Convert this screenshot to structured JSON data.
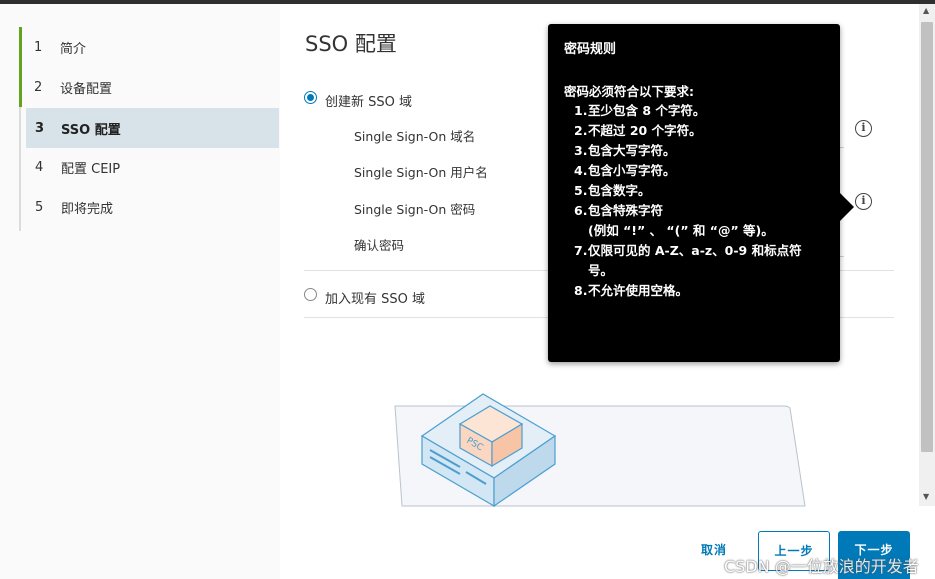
{
  "nav": {
    "items": [
      {
        "num": "1",
        "label": "简介"
      },
      {
        "num": "2",
        "label": "设备配置"
      },
      {
        "num": "3",
        "label": "SSO 配置"
      },
      {
        "num": "4",
        "label": "配置 CEIP"
      },
      {
        "num": "5",
        "label": "即将完成"
      }
    ],
    "accent_color": "#62a420",
    "active_index": 2
  },
  "main": {
    "title": "SSO 配置",
    "option_new": "创建新 SSO 域",
    "option_join": "加入现有 SSO 域",
    "selected_option": "创建新 SSO 域",
    "fields": {
      "domain": "Single Sign-On 域名",
      "username": "Single Sign-On 用户名",
      "password": "Single Sign-On 密码",
      "confirm": "确认密码"
    },
    "illustration_label": "PSC"
  },
  "tooltip": {
    "title": "密码规则",
    "intro": "密码必须符合以下要求:",
    "rules": [
      {
        "n": "1.",
        "text": "至少包含 8 个字符。"
      },
      {
        "n": "2.",
        "text": "不超过 20 个字符。"
      },
      {
        "n": "3.",
        "text": "包含大写字符。"
      },
      {
        "n": "4.",
        "text": "包含小写字符。"
      },
      {
        "n": "5.",
        "text": "包含数字。"
      },
      {
        "n": "6.",
        "text": "包含特殊字符"
      },
      {
        "n": "",
        "text": "(例如 “!” 、 “(” 和 “@” 等)。"
      },
      {
        "n": "7.",
        "text": "仅限可见的 A-Z、a-z、0-9 和标点符"
      },
      {
        "n": "",
        "text": "号。"
      },
      {
        "n": "8.",
        "text": "不允许使用空格。"
      }
    ]
  },
  "footer": {
    "cancel": "取消",
    "prev": "上一步",
    "next": "下一步"
  },
  "watermark": "CSDN @一位放浪的开发者",
  "colors": {
    "primary": "#0079b8",
    "tooltip_bg": "#000000",
    "nav_active_bg": "#d8e3e9"
  }
}
